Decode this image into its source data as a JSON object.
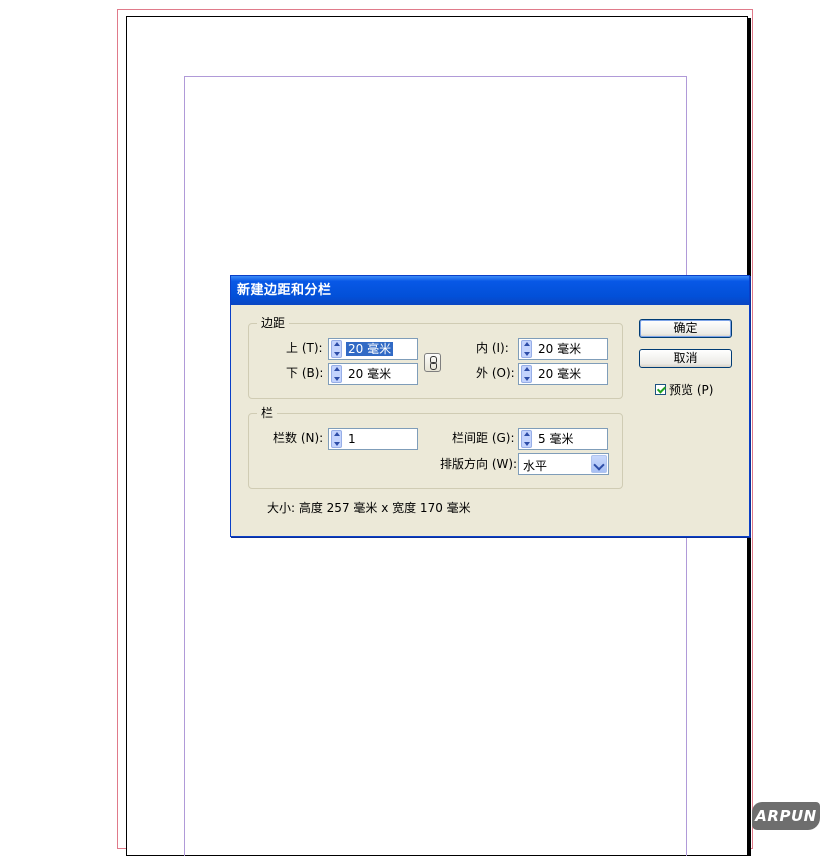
{
  "dialog": {
    "title": "新建边距和分栏",
    "margins_group": "边距",
    "top_label": "上 (T):",
    "top_value": "20 毫米",
    "bottom_label": "下 (B):",
    "bottom_value": "20 毫米",
    "inside_label": "内 (I):",
    "inside_value": "20 毫米",
    "outside_label": "外 (O):",
    "outside_value": "20 毫米",
    "columns_group": "栏",
    "count_label": "栏数 (N):",
    "count_value": "1",
    "gutter_label": "栏间距 (G):",
    "gutter_value": "5 毫米",
    "direction_label": "排版方向 (W):",
    "direction_value": "水平",
    "size_text": "大小: 高度 257 毫米 x 宽度 170 毫米",
    "ok_label": "确定",
    "cancel_label": "取消",
    "preview_label": "预览 (P)",
    "preview_checked": true
  },
  "watermark": "ARPUN",
  "icons": [
    "spin-arrows-icon",
    "chain-link-icon",
    "dropdown-arrow-icon",
    "checkmark-icon"
  ]
}
